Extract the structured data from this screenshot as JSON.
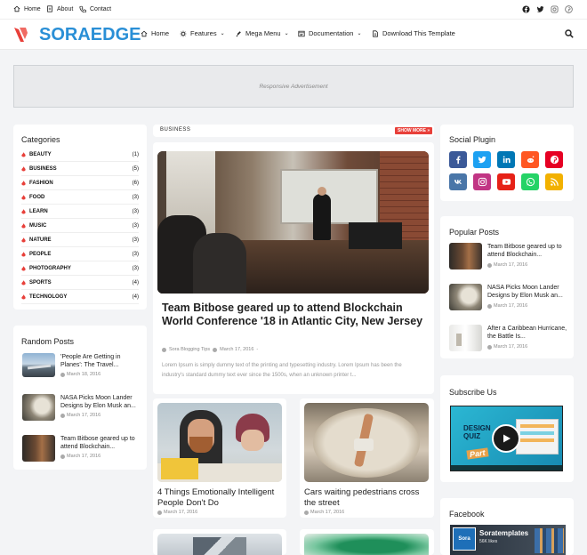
{
  "topbar": {
    "links": [
      {
        "label": "Home",
        "icon": "home-icon"
      },
      {
        "label": "About",
        "icon": "about-icon"
      },
      {
        "label": "Contact",
        "icon": "phone-icon"
      }
    ],
    "social": [
      "facebook-icon",
      "twitter-icon",
      "instagram-icon",
      "pinterest-icon"
    ]
  },
  "header": {
    "logo": "SORAEDGE",
    "nav": [
      {
        "label": "Home",
        "icon": "home-icon"
      },
      {
        "label": "Features",
        "icon": "gear-icon",
        "dropdown": true
      },
      {
        "label": "Mega Menu",
        "icon": "pen-icon",
        "dropdown": true
      },
      {
        "label": "Documentation",
        "icon": "doc-icon",
        "dropdown": true
      },
      {
        "label": "Download This Template",
        "icon": "file-icon"
      }
    ]
  },
  "ad": {
    "label": "Responsive Advertisement"
  },
  "categories": {
    "title": "Categories",
    "items": [
      {
        "label": "BEAUTY",
        "count": "(1)"
      },
      {
        "label": "BUSINESS",
        "count": "(5)"
      },
      {
        "label": "FASHION",
        "count": "(6)"
      },
      {
        "label": "FOOD",
        "count": "(3)"
      },
      {
        "label": "LEARN",
        "count": "(3)"
      },
      {
        "label": "MUSIC",
        "count": "(3)"
      },
      {
        "label": "NATURE",
        "count": "(3)"
      },
      {
        "label": "PEOPLE",
        "count": "(3)"
      },
      {
        "label": "PHOTOGRAPHY",
        "count": "(3)"
      },
      {
        "label": "SPORTS",
        "count": "(4)"
      },
      {
        "label": "TECHNOLOGY",
        "count": "(4)"
      }
    ]
  },
  "random": {
    "title": "Random Posts",
    "posts": [
      {
        "title": "'People Are Getting in Planes': The Travel...",
        "date": "March 18, 2016"
      },
      {
        "title": "NASA Picks Moon Lander Designs by Elon Musk an...",
        "date": "March 17, 2016"
      },
      {
        "title": "Team Bitbose geared up to attend Blockchain...",
        "date": "March 17, 2016"
      }
    ]
  },
  "business": {
    "label": "BUSINESS",
    "more": "SHOW MORE »"
  },
  "featured": {
    "title": "Team Bitbose geared up to attend Blockchain World Conference '18 in Atlantic City, New Jersey",
    "author": "Sora Blogging Tips",
    "date": "March 17, 2016",
    "dot": "-",
    "excerpt": "Lorem Ipsum is simply dummy text of the printing and typesetting industry. Lorem Ipsum has been the industry's standard dummy text ever since the 1500s, when an unknown printer t..."
  },
  "grid": [
    {
      "title": "4 Things Emotionally Intelligent People Don't Do",
      "date": "March 17, 2016"
    },
    {
      "title": "Cars waiting pedestrians cross the street",
      "date": "March 17, 2016"
    }
  ],
  "social_plugin": {
    "title": "Social Plugin",
    "buttons": [
      {
        "icon": "facebook-icon",
        "color": "#3b5998"
      },
      {
        "icon": "twitter-icon",
        "color": "#1da1f2"
      },
      {
        "icon": "linkedin-icon",
        "color": "#0077b5"
      },
      {
        "icon": "reddit-icon",
        "color": "#ff5722"
      },
      {
        "icon": "pinterest-icon",
        "color": "#e60023"
      },
      {
        "icon": "vk-icon",
        "color": "#4a76a8"
      },
      {
        "icon": "instagram-icon",
        "color": "#c13584"
      },
      {
        "icon": "youtube-icon",
        "color": "#e62117"
      },
      {
        "icon": "whatsapp-icon",
        "color": "#25d366"
      },
      {
        "icon": "rss-icon",
        "color": "#f2b100"
      }
    ]
  },
  "popular": {
    "title": "Popular Posts",
    "posts": [
      {
        "title": "Team Bitbose geared up to attend Blockchain...",
        "date": "March 17, 2016"
      },
      {
        "title": "NASA Picks Moon Lander Designs by Elon Musk an...",
        "date": "March 17, 2016"
      },
      {
        "title": "After a Caribbean Hurricane, the Battle Is...",
        "date": "March 17, 2016"
      }
    ]
  },
  "subscribe": {
    "title": "Subscribe Us",
    "video_text_1": "DESIGN",
    "video_text_2": "QUIZ",
    "video_text_3": "Part"
  },
  "facebook": {
    "title": "Facebook",
    "page": "Soratemplates",
    "likes": "56K likes",
    "logo": "Sora"
  },
  "colors": {
    "accent": "#e8403a",
    "brand": "#2a8fd6"
  }
}
